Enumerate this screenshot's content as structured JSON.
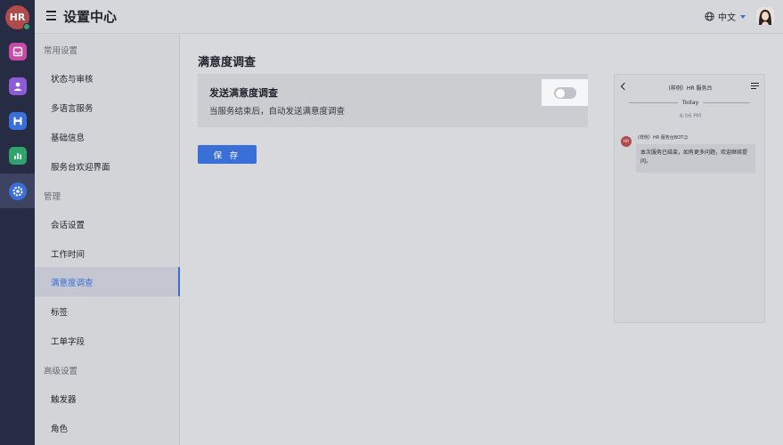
{
  "rail": {
    "avatar_text": "HR",
    "items": [
      {
        "icon": "inbox-icon",
        "color": "#c84aa6"
      },
      {
        "icon": "user-icon",
        "color": "#8b5cd6"
      },
      {
        "icon": "save-icon",
        "color": "#3a6fd8"
      },
      {
        "icon": "chart-icon",
        "color": "#2fa36b"
      },
      {
        "icon": "gear-icon",
        "color": "#3a6fd8"
      }
    ]
  },
  "header": {
    "title": "设置中心",
    "language": "中文"
  },
  "sidebar": {
    "groups": [
      {
        "label": "常用设置",
        "items": [
          "状态与审核",
          "多语言服务",
          "基础信息",
          "服务台欢迎界面"
        ]
      },
      {
        "label": "管理",
        "items": [
          "会话设置",
          "工作时间",
          "满意度调查",
          "标签",
          "工单字段"
        ]
      },
      {
        "label": "高级设置",
        "items": [
          "触发器",
          "角色"
        ]
      }
    ],
    "active_item": "满意度调查"
  },
  "main": {
    "page_title": "满意度调查",
    "setting_title": "发送满意度调查",
    "setting_desc": "当服务结束后，自动发送满意度调查",
    "toggle_on": false,
    "save_label": "保 存"
  },
  "preview": {
    "title": "(样例）HR 服务台",
    "today": "Today",
    "time": "6:06 PM",
    "bot_avatar": "HR",
    "bot_name": "(样例）HR 服务台BOT☺",
    "message": "本次服务已结束，如有更多问题，欢迎继续提问。"
  },
  "colors": {
    "accent": "#3a6fd8",
    "rail_bg": "#272c45"
  }
}
